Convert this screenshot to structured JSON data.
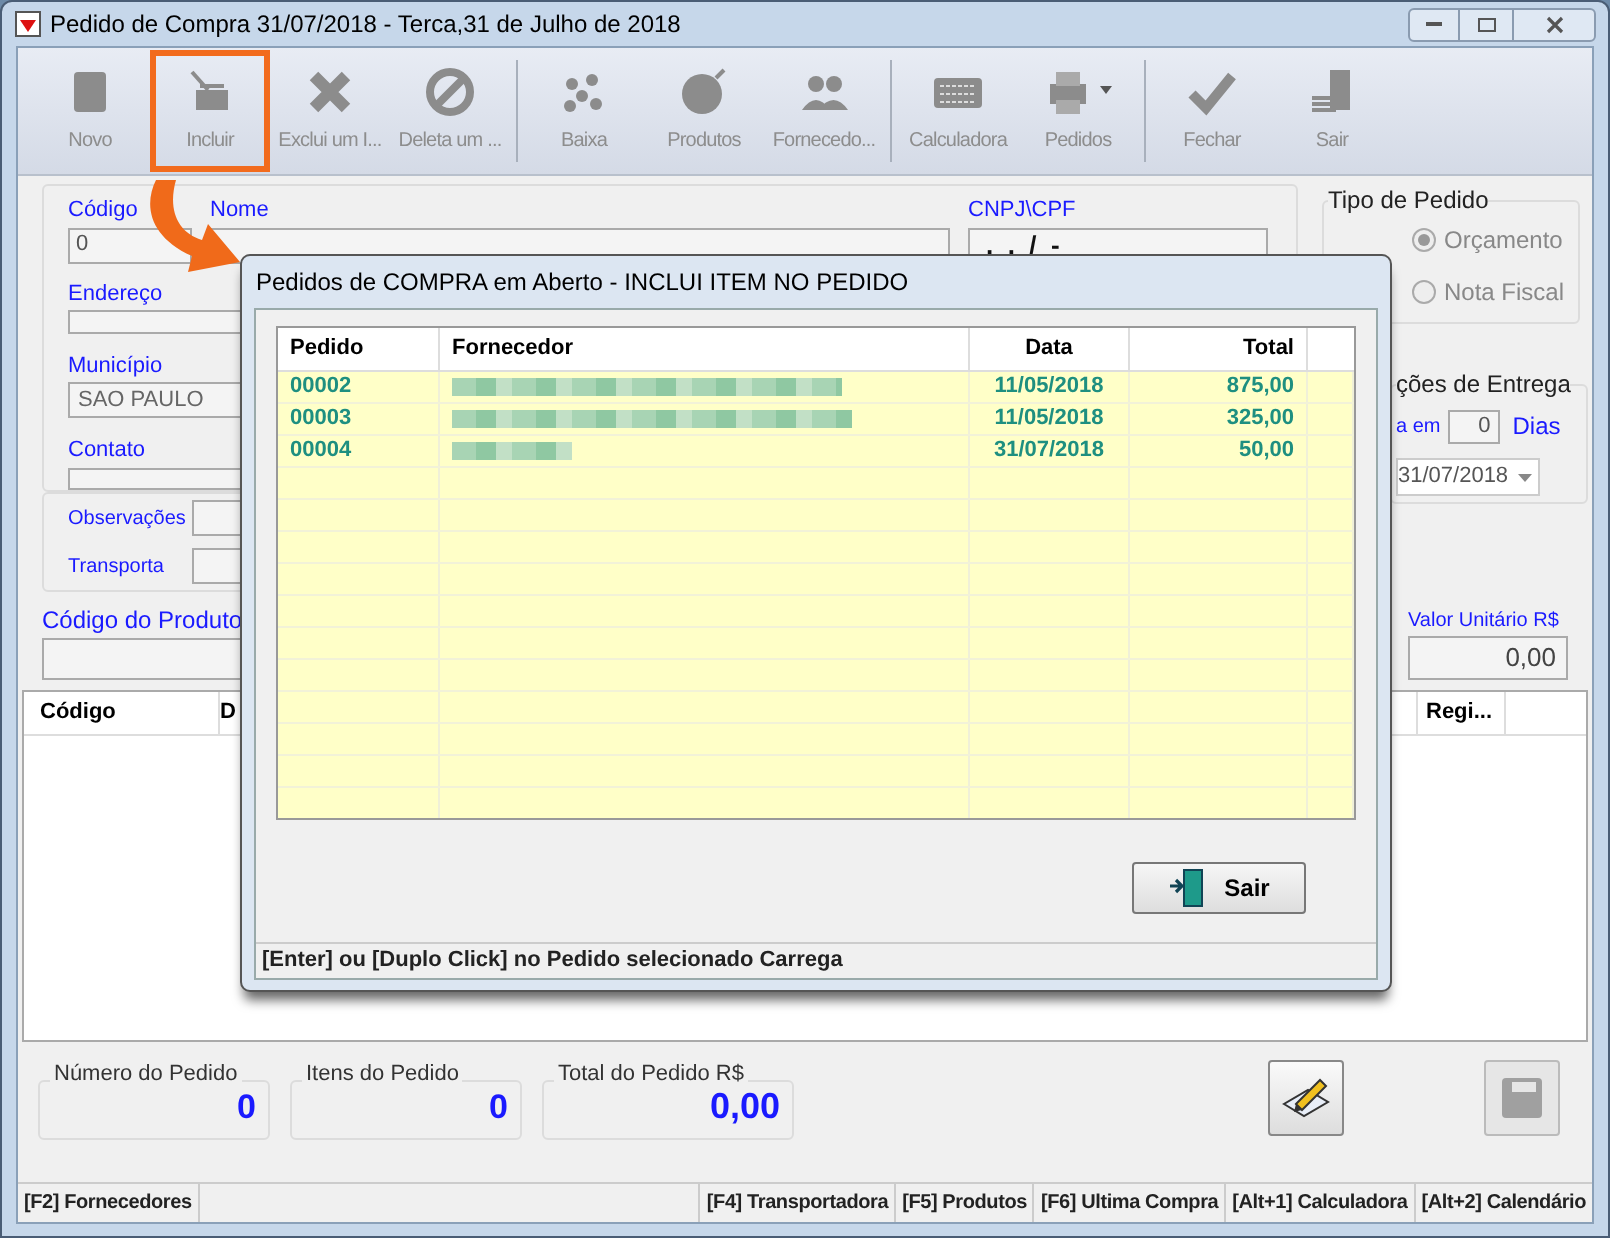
{
  "window": {
    "title": "Pedido de Compra 31/07/2018 - Terca,31 de Julho de 2018"
  },
  "toolbar": [
    {
      "kind": "button",
      "label": "Novo",
      "disabled": true,
      "highlighted": false
    },
    {
      "kind": "button",
      "label": "Incluir",
      "disabled": true,
      "highlighted": true
    },
    {
      "kind": "button",
      "label": "Exclui um I...",
      "disabled": true,
      "highlighted": false
    },
    {
      "kind": "button",
      "label": "Deleta um ...",
      "disabled": true,
      "highlighted": false
    },
    {
      "kind": "separator"
    },
    {
      "kind": "button",
      "label": "Baixa",
      "disabled": true,
      "highlighted": false
    },
    {
      "kind": "button",
      "label": "Produtos",
      "disabled": true,
      "highlighted": false
    },
    {
      "kind": "button",
      "label": "Fornecedo...",
      "disabled": true,
      "highlighted": false
    },
    {
      "kind": "separator"
    },
    {
      "kind": "button",
      "label": "Calculadora",
      "disabled": true,
      "highlighted": false
    },
    {
      "kind": "dropdown",
      "label": "Pedidos",
      "disabled": true,
      "highlighted": false
    },
    {
      "kind": "separator"
    },
    {
      "kind": "button",
      "label": "Fechar",
      "disabled": true,
      "highlighted": false
    },
    {
      "kind": "button",
      "label": "Sair",
      "disabled": true,
      "highlighted": false
    }
  ],
  "form": {
    "codigo": {
      "label": "Código",
      "value": "0"
    },
    "nome": {
      "label": "Nome"
    },
    "cnpj": {
      "label": "CNPJ\\CPF",
      "value": ".  .  /  -"
    },
    "endereco": {
      "label": "Endereço"
    },
    "municipio": {
      "label": "Município",
      "value": "SAO PAULO"
    },
    "contato": {
      "label": "Contato"
    },
    "observacoes": {
      "label": "Observações"
    },
    "transporta": {
      "label": "Transporta"
    }
  },
  "tipo_pedido": {
    "title": "Tipo de Pedido",
    "options": [
      {
        "label": "Orçamento",
        "selected": true
      },
      {
        "label": "Nota Fiscal",
        "selected": false
      }
    ]
  },
  "entrega": {
    "title": "ções de Entrega",
    "prefix": "a em",
    "days": "0",
    "days_label": "Dias",
    "date": "31/07/2018"
  },
  "produto": {
    "label": "Código do Produto"
  },
  "valor_unitario": {
    "label": "Valor Unitário R$",
    "value": "0,00"
  },
  "items_table": {
    "columns": [
      "Código",
      "D",
      "Regi..."
    ]
  },
  "summary": [
    {
      "label": "Número do Pedido",
      "value": "0"
    },
    {
      "label": "Itens do Pedido",
      "value": "0"
    },
    {
      "label": "Total do Pedido R$",
      "value": "0,00"
    }
  ],
  "status_bar": [
    "[F2] Fornecedores",
    "[F4] Transportadora",
    "[F5] Produtos",
    "[F6] Ultima Compra",
    "[Alt+1] Calculadora",
    "[Alt+2] Calendário"
  ],
  "dialog": {
    "title": "Pedidos de COMPRA em Aberto - INCLUI ITEM NO PEDIDO",
    "columns": [
      "Pedido",
      "Fornecedor",
      "Data",
      "Total"
    ],
    "rows": [
      {
        "pedido": "00002",
        "fornecedor_redacted": true,
        "data": "11/05/2018",
        "total": "875,00"
      },
      {
        "pedido": "00003",
        "fornecedor_redacted": true,
        "data": "11/05/2018",
        "total": "325,00"
      },
      {
        "pedido": "00004",
        "fornecedor_redacted": true,
        "data": "31/07/2018",
        "total": "50,00"
      }
    ],
    "button": "Sair",
    "hint": "[Enter] ou [Duplo Click] no Pedido selecionado Carrega"
  }
}
